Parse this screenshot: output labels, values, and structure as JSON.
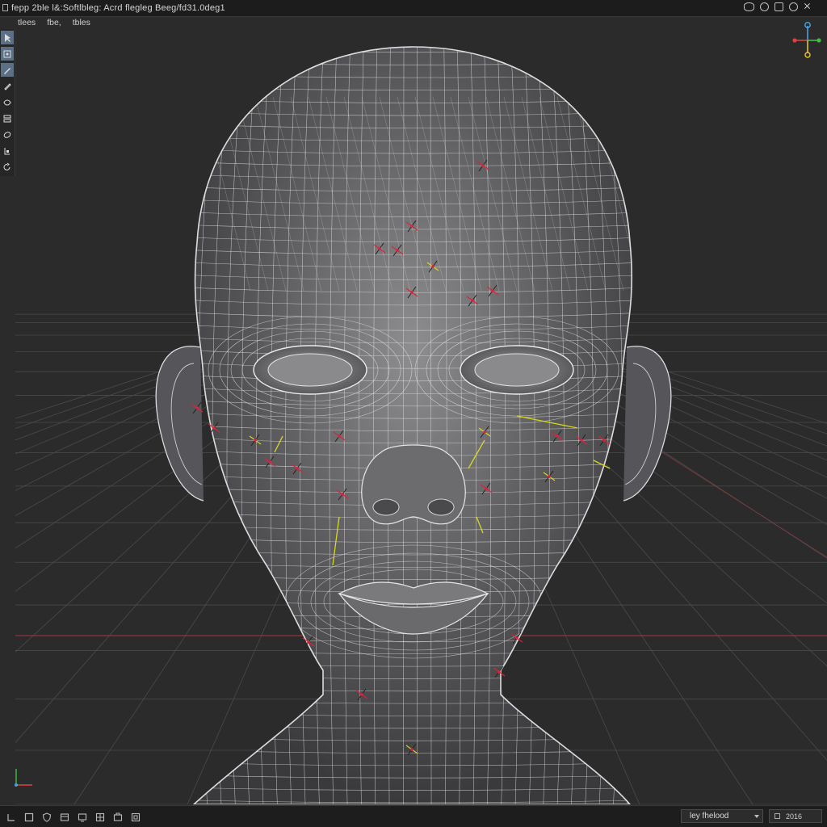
{
  "window": {
    "title": "fepp 2ble l&:Softlbleg: Acrd flegleg Beeg/fd31.0deg1"
  },
  "menubar": {
    "items": [
      "tlees",
      "fbe,",
      "tbles"
    ]
  },
  "toolbar": {
    "tools": [
      {
        "name": "select-tool",
        "icon": "cursor-icon",
        "active": true
      },
      {
        "name": "move-tool",
        "icon": "move-icon",
        "active": true
      },
      {
        "name": "brush-tool",
        "icon": "brush-icon",
        "active": true
      },
      {
        "name": "pen-tool",
        "icon": "pen-icon",
        "active": false
      },
      {
        "name": "sculpt-tool",
        "icon": "sculpt-icon",
        "active": false
      },
      {
        "name": "layers-tool",
        "icon": "layers-icon",
        "active": false
      },
      {
        "name": "smooth-tool",
        "icon": "smooth-icon",
        "active": false
      },
      {
        "name": "paint-tool",
        "icon": "paint-icon",
        "active": false
      },
      {
        "name": "rotate-tool",
        "icon": "rotate-icon",
        "active": false
      }
    ]
  },
  "bottombar": {
    "layer_label": "ley fhelood",
    "mode_label": "2016"
  },
  "colors": {
    "background": "#2b2b2c",
    "grid": "#4b4b4d",
    "x_axis": "#a03a3a",
    "wireframe": "#e8e8e8",
    "marker_red": "#e0203a",
    "marker_yellow": "#d8d820",
    "gizmo_blue": "#4aa0e0",
    "gizmo_red": "#e04040",
    "gizmo_green": "#40c040",
    "gizmo_yellow": "#e0c030"
  },
  "viewport": {
    "object": "head-mesh-wireframe",
    "icon": "3d-viewport"
  }
}
